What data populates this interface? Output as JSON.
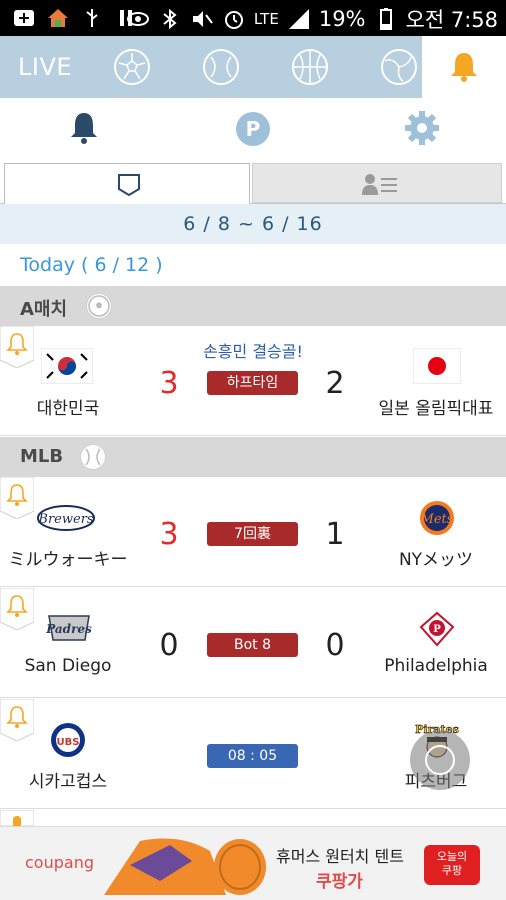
{
  "status_bar": {
    "signal_label": "LTE",
    "battery_percent": "19%",
    "time": "오전 7:58"
  },
  "sport_tabs": {
    "live_label": "LIVE",
    "icons": [
      "soccer-ball-icon",
      "baseball-icon",
      "basketball-icon",
      "volleyball-icon",
      "bell-icon"
    ]
  },
  "tabs": {
    "schedule_icon": "shield-icon",
    "players_icon": "player-list-icon"
  },
  "date_range": "6 / 8  ~  6 / 16",
  "today_label": "Today ( 6 / 12 )",
  "sections": [
    {
      "label": "A매치",
      "icon": "soccer-ball-icon",
      "games": [
        {
          "home": "대한민국",
          "away": "일본 올림픽대표",
          "home_score": "3",
          "away_score": "2",
          "status": "하프타임",
          "headline": "손흥민 결승골!"
        }
      ]
    },
    {
      "label": "MLB",
      "icon": "baseball-icon",
      "games": [
        {
          "home": "ミルウォーキー",
          "away": "NYメッツ",
          "home_score": "3",
          "away_score": "1",
          "status": "7回裏"
        },
        {
          "home": "San Diego",
          "away": "Philadelphia",
          "home_score": "0",
          "away_score": "0",
          "status": "Bot 8"
        },
        {
          "home": "시카고컵스",
          "away": "피츠버그",
          "home_score": "",
          "away_score": "",
          "status": "08 : 05"
        }
      ]
    }
  ],
  "ad": {
    "brand": "coupang",
    "title": "휴머스 원터치 텐트",
    "subtitle": "쿠팡가",
    "button_label_1": "오늘의",
    "button_label_2": "쿠팡"
  },
  "colors": {
    "accent": "#3a97d9",
    "live_status": "#a92a2a",
    "scheduled_status": "#3a67b3",
    "score_leader": "#e32b2b",
    "bell": "#f5a623"
  }
}
